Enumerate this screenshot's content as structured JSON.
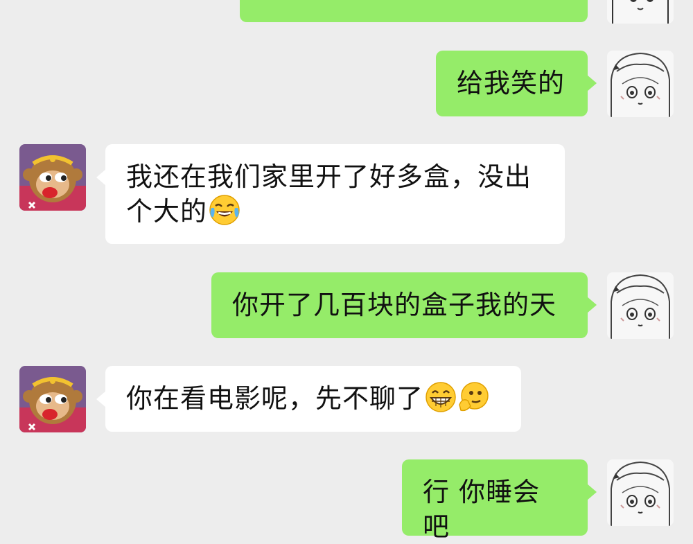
{
  "messages": [
    {
      "side": "right",
      "text": "",
      "partial": true
    },
    {
      "side": "right",
      "text": "给我笑的"
    },
    {
      "side": "left",
      "line1": "我还在我们家里开了好多盒，没出",
      "line2": "个大的",
      "emoji": "face-with-tears-of-joy-icon"
    },
    {
      "side": "right",
      "text": "你开了几百块的盒子我的天"
    },
    {
      "side": "left",
      "text": "你在看电影呢，先不聊了",
      "emojis": [
        "grinning-face-icon",
        "thinking-hand-face-icon"
      ]
    },
    {
      "side": "right",
      "text": "行 你睡会吧"
    }
  ],
  "colors": {
    "background": "#ededed",
    "sent_bubble": "#95ec69",
    "received_bubble": "#ffffff"
  }
}
